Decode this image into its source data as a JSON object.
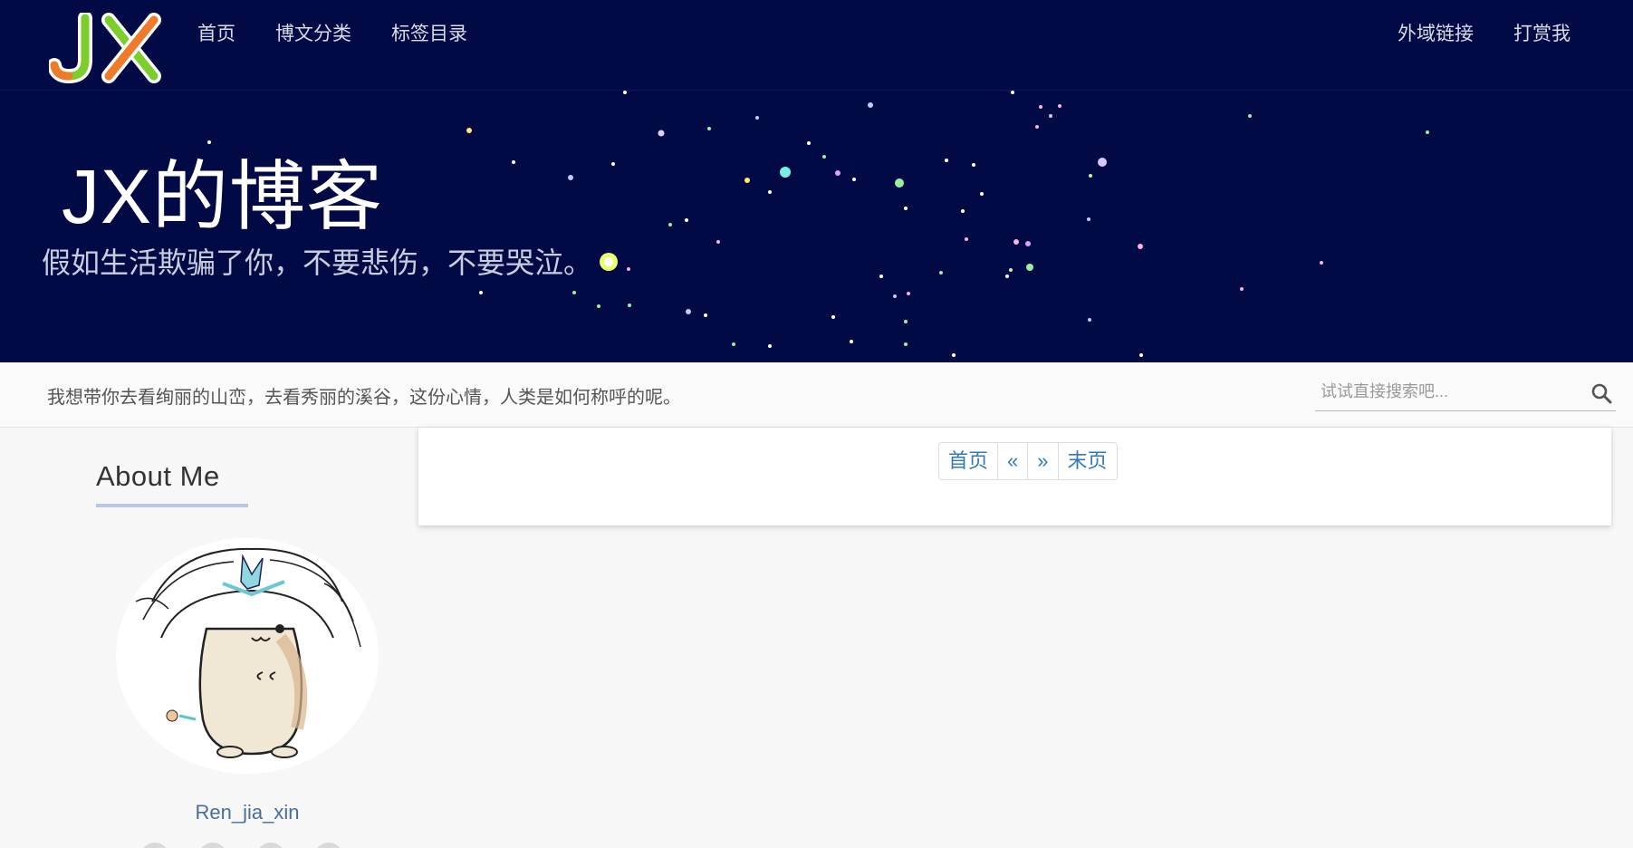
{
  "nav": {
    "logo_text": "JX",
    "left_items": [
      {
        "label": "首页"
      },
      {
        "label": "博文分类"
      },
      {
        "label": "标签目录"
      }
    ],
    "right_items": [
      {
        "label": "外域链接"
      },
      {
        "label": "打赏我"
      }
    ]
  },
  "hero": {
    "title": "JX的博客",
    "subtitle": "假如生活欺骗了你，不要悲伤，不要哭泣。"
  },
  "notice": {
    "text": "我想带你去看绚丽的山峦，去看秀丽的溪谷，这份心情，人类是如何称呼的呢。",
    "search_placeholder": "试试直接搜索吧..."
  },
  "sidebar": {
    "about_title": "About Me",
    "username": "Ren_jia_xin"
  },
  "pagination": {
    "first": "首页",
    "prev": "«",
    "next": "»",
    "last": "末页"
  },
  "colors": {
    "nav_bg": "#010a44",
    "link": "#337ab7",
    "username": "#4a6e9a"
  }
}
